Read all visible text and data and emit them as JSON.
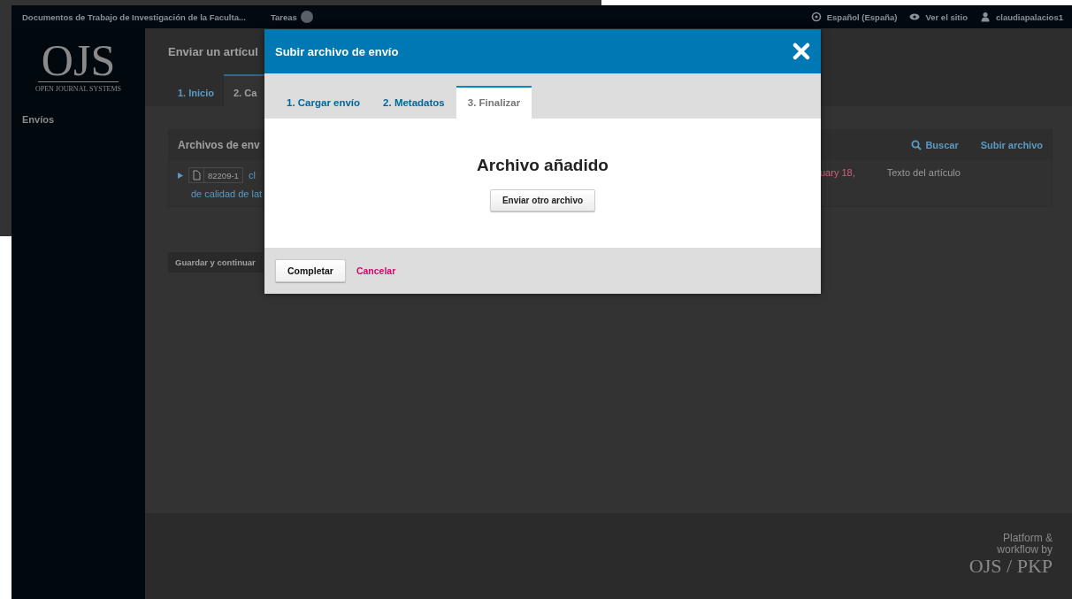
{
  "top_bar": {
    "site_title": "Documentos de Trabajo de Investigación de la Faculta...",
    "tasks": {
      "label": "Tareas"
    },
    "links": [
      {
        "kind": "language",
        "label": "Español (España)"
      },
      {
        "kind": "view",
        "label": "Ver el sitio"
      },
      {
        "kind": "user",
        "label": "claudiapalacios1"
      }
    ]
  },
  "sidebar": {
    "logo": {
      "wordmark": "OJS",
      "tagline": "OPEN JOURNAL SYSTEMS"
    },
    "items": [
      {
        "label": "Envíos"
      }
    ]
  },
  "page": {
    "title": "Enviar un artícul",
    "tabs": [
      {
        "label": "1. Inicio",
        "selected": false
      },
      {
        "label": "2. Ca",
        "selected": true
      }
    ],
    "files_panel": {
      "title": "Archivos de env",
      "actions": [
        {
          "kind": "search",
          "label": "Buscar"
        },
        {
          "kind": "upload",
          "label": "Subir archivo"
        }
      ],
      "rows": [
        {
          "id": "82209-1",
          "name_start": "cl",
          "name_line2": "de calidad de lat",
          "date": "uary 18,",
          "component": "Texto del artículo"
        }
      ]
    },
    "save_button": "Guardar y continuar"
  },
  "footer": {
    "line1": "Platform &",
    "line2": "workflow by",
    "brand": "OJS / PKP"
  },
  "modal": {
    "title": "Subir archivo de envío",
    "tabs": [
      {
        "label": "1. Cargar envío",
        "selected": false
      },
      {
        "label": "2. Metadatos",
        "selected": false
      },
      {
        "label": "3. Finalizar",
        "selected": true
      }
    ],
    "message": "Archivo añadido",
    "another_button": "Enviar otro archivo",
    "buttons": [
      {
        "kind": "primary",
        "label": "Completar"
      },
      {
        "kind": "cancel",
        "label": "Cancelar"
      }
    ]
  }
}
